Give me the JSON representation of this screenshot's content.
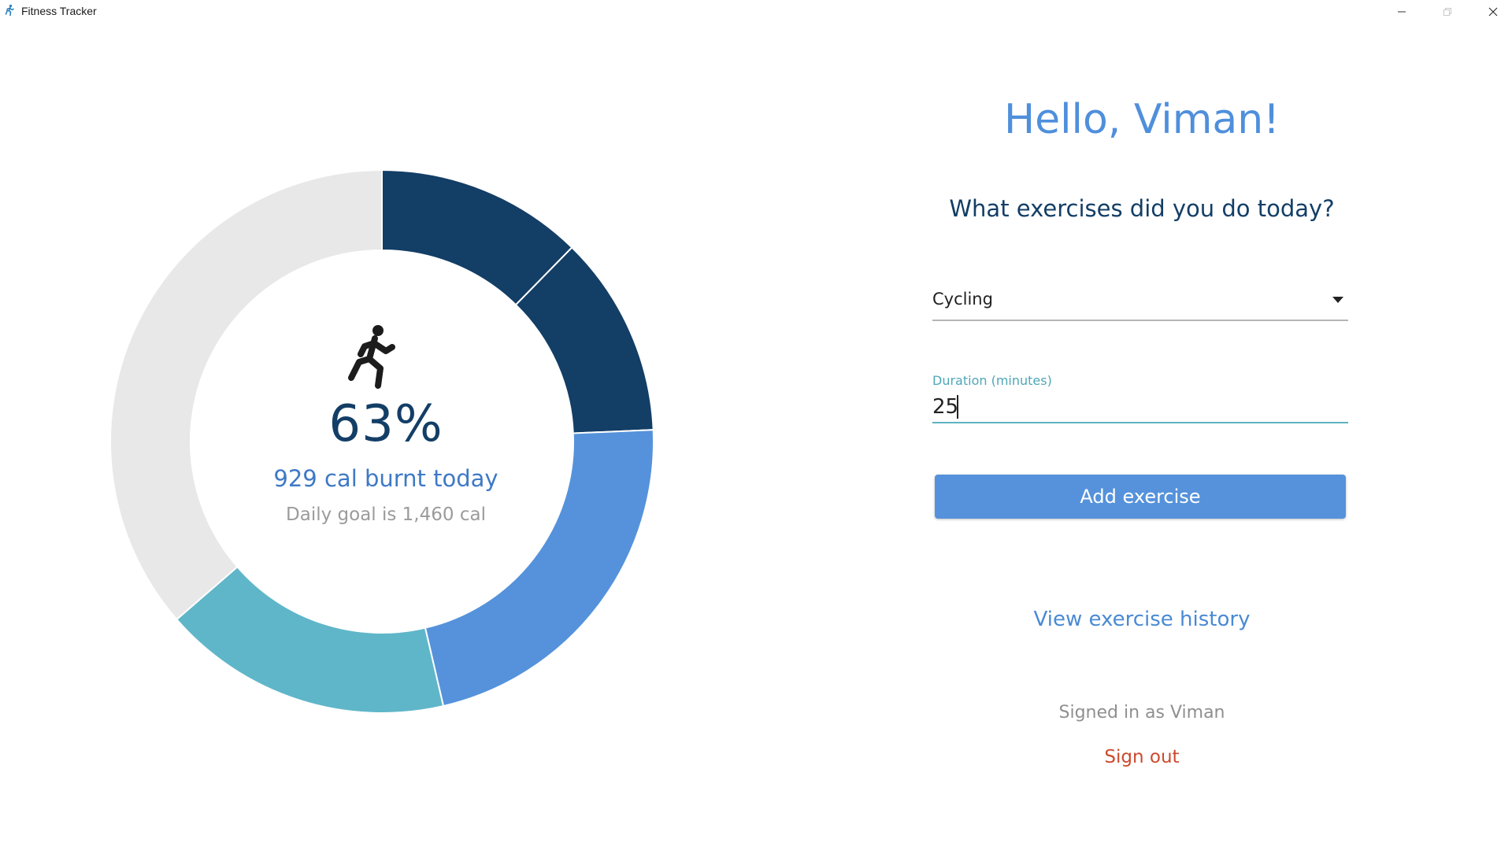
{
  "window": {
    "title": "Fitness Tracker",
    "icon": "runner-icon"
  },
  "progress": {
    "percent_text": "63%",
    "burnt_text": "929 cal burnt today",
    "goal_text": "Daily goal is 1,460 cal"
  },
  "chart_data": {
    "type": "pie",
    "variant": "donut",
    "unit": "cal",
    "goal": 1460,
    "burnt_total": 929,
    "slices": [
      {
        "value": 180,
        "color": "#133e66"
      },
      {
        "value": 175,
        "color": "#133e66"
      },
      {
        "value": 322,
        "color": "#5592db"
      },
      {
        "value": 252,
        "color": "#5fb6c9"
      },
      {
        "value": 531,
        "color": "#e8e8e8"
      }
    ]
  },
  "main": {
    "greeting": "Hello, Viman!",
    "question": "What exercises did you do today?",
    "exercise_select": {
      "selected": "Cycling"
    },
    "duration": {
      "label": "Duration (minutes)",
      "value": "25"
    },
    "add_button_label": "Add exercise",
    "history_link": "View exercise history",
    "signed_in_text": "Signed in as Viman",
    "sign_out_label": "Sign out"
  },
  "colors": {
    "accent": "#5592db",
    "dark_navy": "#133e66",
    "teal": "#5fb6c9",
    "danger": "#cc4a2e"
  }
}
